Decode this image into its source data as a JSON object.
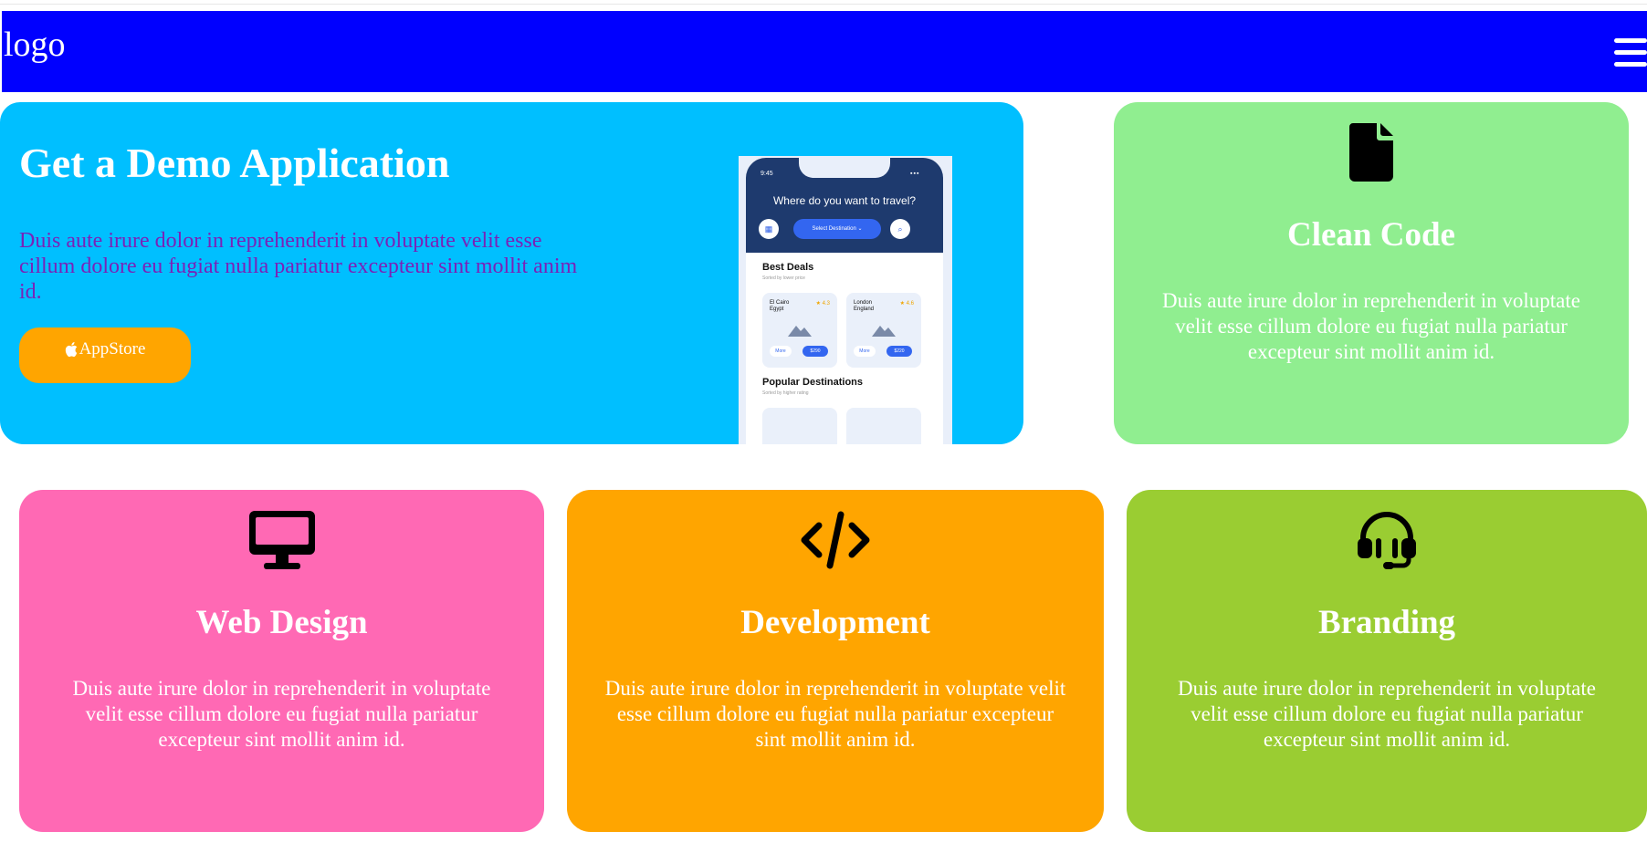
{
  "header": {
    "logo": "logo",
    "menu_icon": "hamburger-menu-icon",
    "background": "#0000ff"
  },
  "hero": {
    "title": "Get a Demo Application",
    "description": "Duis aute irure dolor in reprehenderit in voluptate velit esse cillum dolore eu fugiat nulla pariatur excepteur sint mollit anim id.",
    "button_label": "AppStore",
    "button_icon": "apple-icon",
    "background": "#00bfff",
    "phone": {
      "time": "9:45",
      "question": "Where do you want to travel?",
      "select_label": "Select Destination",
      "best_deals": "Best Deals",
      "best_deals_sub": "Sorted by lower price",
      "deals": [
        {
          "city": "El Cairo",
          "country": "Egypt",
          "rating": "★ 4.3",
          "more": "More",
          "price": "$290"
        },
        {
          "city": "London",
          "country": "England",
          "rating": "★ 4.6",
          "more": "More",
          "price": "$220"
        }
      ],
      "popular": "Popular Destinations",
      "popular_sub": "Sorted by higher rating"
    }
  },
  "cards": [
    {
      "title": "Clean Code",
      "icon": "file-icon",
      "description": "Duis aute irure dolor in reprehenderit in voluptate velit esse cillum dolore eu fugiat nulla pariatur excepteur sint mollit anim id.",
      "color": "#90ee90"
    },
    {
      "title": "Web Design",
      "icon": "desktop-icon",
      "description": "Duis aute irure dolor in reprehenderit in voluptate velit esse cillum dolore eu fugiat nulla pariatur excepteur sint mollit anim id.",
      "color": "#ff69b4"
    },
    {
      "title": "Development",
      "icon": "code-icon",
      "description": "Duis aute irure dolor in reprehenderit in voluptate velit esse cillum dolore eu fugiat nulla pariatur excepteur sint mollit anim id.",
      "color": "#ffa500"
    },
    {
      "title": "Branding",
      "icon": "headset-icon",
      "description": "Duis aute irure dolor in reprehenderit in voluptate velit esse cillum dolore eu fugiat nulla pariatur excepteur sint mollit anim id.",
      "color": "#9acd32"
    }
  ]
}
